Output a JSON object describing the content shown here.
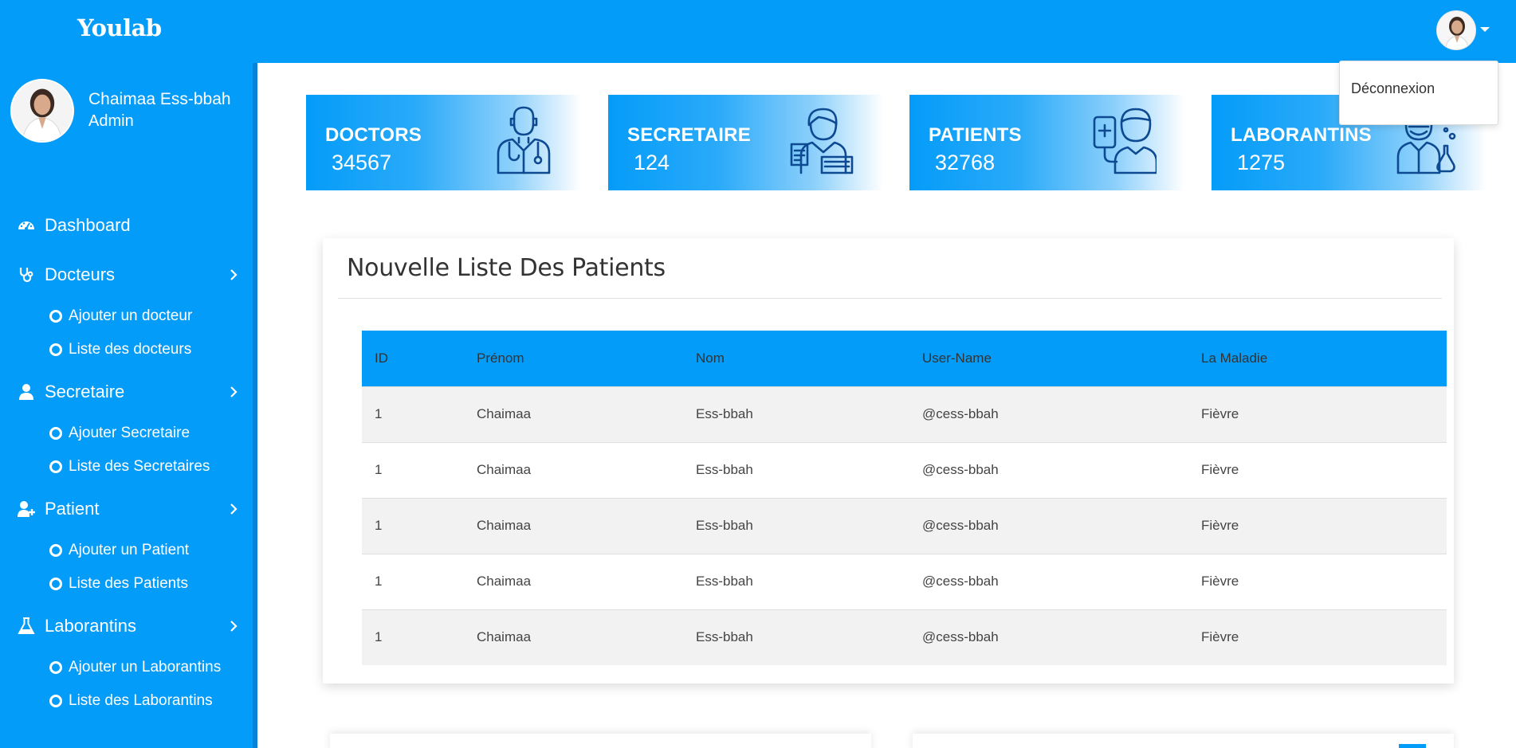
{
  "app": {
    "brand": "Youlab"
  },
  "header": {
    "dropdown_logout": "Déconnexion"
  },
  "profile": {
    "name": "Chaimaa Ess-bbah",
    "role": "Admin"
  },
  "sidebar": {
    "items": [
      {
        "label": "Dashboard",
        "icon": "dashboard-icon"
      },
      {
        "label": "Docteurs",
        "icon": "stethoscope-icon",
        "children": [
          "Ajouter un docteur",
          "Liste des docteurs"
        ]
      },
      {
        "label": "Secretaire",
        "icon": "user-icon",
        "children": [
          "Ajouter Secretaire",
          "Liste des Secretaires"
        ]
      },
      {
        "label": "Patient",
        "icon": "user-plus-icon",
        "children": [
          "Ajouter un Patient",
          "Liste des Patients"
        ]
      },
      {
        "label": "Laborantins",
        "icon": "flask-icon",
        "children": [
          "Ajouter un Laborantins",
          "Liste des Laborantins"
        ]
      }
    ]
  },
  "stats": [
    {
      "title": "DOCTORS",
      "count": "34567",
      "icon": "doctor-icon"
    },
    {
      "title": "SECRETAIRE",
      "count": "124",
      "icon": "secretary-icon"
    },
    {
      "title": "PATIENTS",
      "count": "32768",
      "icon": "patient-icon"
    },
    {
      "title": "LABORANTINS",
      "count": "1275",
      "icon": "lab-technician-icon"
    }
  ],
  "patients_panel": {
    "title": "Nouvelle Liste Des Patients",
    "columns": [
      "ID",
      "Prénom",
      "Nom",
      "User-Name",
      "La Maladie"
    ],
    "rows": [
      [
        "1",
        "Chaimaa",
        "Ess-bbah",
        "@cess-bbah",
        "Fièvre"
      ],
      [
        "1",
        "Chaimaa",
        "Ess-bbah",
        "@cess-bbah",
        "Fièvre"
      ],
      [
        "1",
        "Chaimaa",
        "Ess-bbah",
        "@cess-bbah",
        "Fièvre"
      ],
      [
        "1",
        "Chaimaa",
        "Ess-bbah",
        "@cess-bbah",
        "Fièvre"
      ],
      [
        "1",
        "Chaimaa",
        "Ess-bbah",
        "@cess-bbah",
        "Fièvre"
      ]
    ]
  },
  "colors": {
    "primary": "#049cf9",
    "icon_stroke": "#0d4a91",
    "row_alt": "#f2f2f2"
  }
}
